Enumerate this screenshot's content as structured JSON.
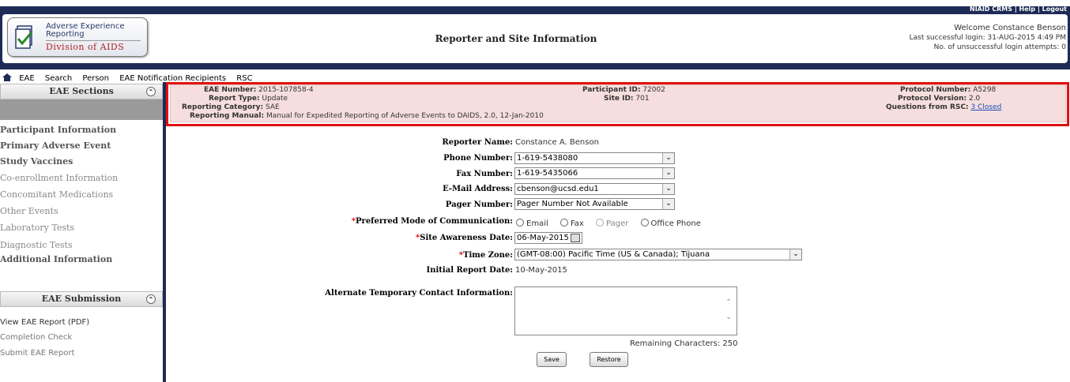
{
  "top_links": {
    "crms": "NIAID CRMS",
    "sep1": "|",
    "help": "Help",
    "sep2": "|",
    "logout": "Logout"
  },
  "logo": {
    "line1": "Adverse Experience",
    "line2": "Reporting",
    "division": "Division of AIDS"
  },
  "page_title": "Reporter and Site Information",
  "welcome": {
    "greeting": "Welcome Constance Benson",
    "last_login": "Last successful login: 31-AUG-2015 4:49 PM",
    "attempts": "No. of unsuccessful login attempts: 0"
  },
  "nav": {
    "eae": "EAE",
    "search": "Search",
    "person": "Person",
    "notif": "EAE Notification Recipients",
    "rsc": "RSC"
  },
  "sidebar": {
    "sections_title": "EAE Sections",
    "items": [
      {
        "label": "Participant Information",
        "bold": true
      },
      {
        "label": "Primary Adverse Event",
        "bold": true
      },
      {
        "label": "Study Vaccines",
        "bold": true
      },
      {
        "label": "Co-enrollment Information",
        "bold": false
      },
      {
        "label": "Concomitant Medications",
        "bold": false
      },
      {
        "label": "Other Events",
        "bold": false
      },
      {
        "label": "Laboratory Tests",
        "bold": false
      },
      {
        "label": "Diagnostic Tests",
        "bold": false
      },
      {
        "label": "Additional Information",
        "bold": true
      }
    ],
    "submission_title": "EAE Submission",
    "submission_items": [
      "View EAE Report (PDF)",
      "Completion Check",
      "Submit EAE Report"
    ]
  },
  "info": {
    "eae_number_label": "EAE Number:",
    "eae_number": "2015-107858-4",
    "report_type_label": "Report Type:",
    "report_type": "Update",
    "reporting_category_label": "Reporting Category:",
    "reporting_category": "SAE",
    "reporting_manual_label": "Reporting Manual:",
    "reporting_manual": "Manual for Expedited Reporting of Adverse Events to DAIDS, 2.0, 12-Jan-2010",
    "participant_id_label": "Participant ID:",
    "participant_id": "72002",
    "site_id_label": "Site ID:",
    "site_id": "701",
    "protocol_number_label": "Protocol Number:",
    "protocol_number": "A5298",
    "protocol_version_label": "Protocol Version:",
    "protocol_version": "2.0",
    "questions_label": "Questions from RSC:",
    "questions": "3 Closed"
  },
  "form": {
    "reporter_name_label": "Reporter Name:",
    "reporter_name": "Constance A. Benson",
    "phone_label": "Phone Number:",
    "phone": "1-619-5438080",
    "fax_label": "Fax Number:",
    "fax": "1-619-5435066",
    "email_label": "E-Mail Address:",
    "email": "cbenson@ucsd.edu1",
    "pager_label": "Pager Number:",
    "pager": "Pager Number Not Available",
    "mode_label": "Preferred Mode of Communication:",
    "mode_options": [
      "Email",
      "Fax",
      "Pager",
      "Office Phone"
    ],
    "awareness_label": "Site Awareness Date:",
    "awareness_date": "06-May-2015",
    "timezone_label": "Time Zone:",
    "timezone": "(GMT-08:00) Pacific Time (US & Canada); Tijuana",
    "initial_date_label": "Initial Report Date:",
    "initial_date": "10-May-2015",
    "alt_contact_label": "Alternate Temporary Contact Information:",
    "remaining": "Remaining Characters: 250",
    "save": "Save",
    "restore": "Restore"
  },
  "colors": {
    "header_navy": "#1d2b55",
    "info_pink": "#f5dedd",
    "highlight_red": "#e01010",
    "division_red": "#b22222",
    "link_blue": "#1a4fbf"
  }
}
